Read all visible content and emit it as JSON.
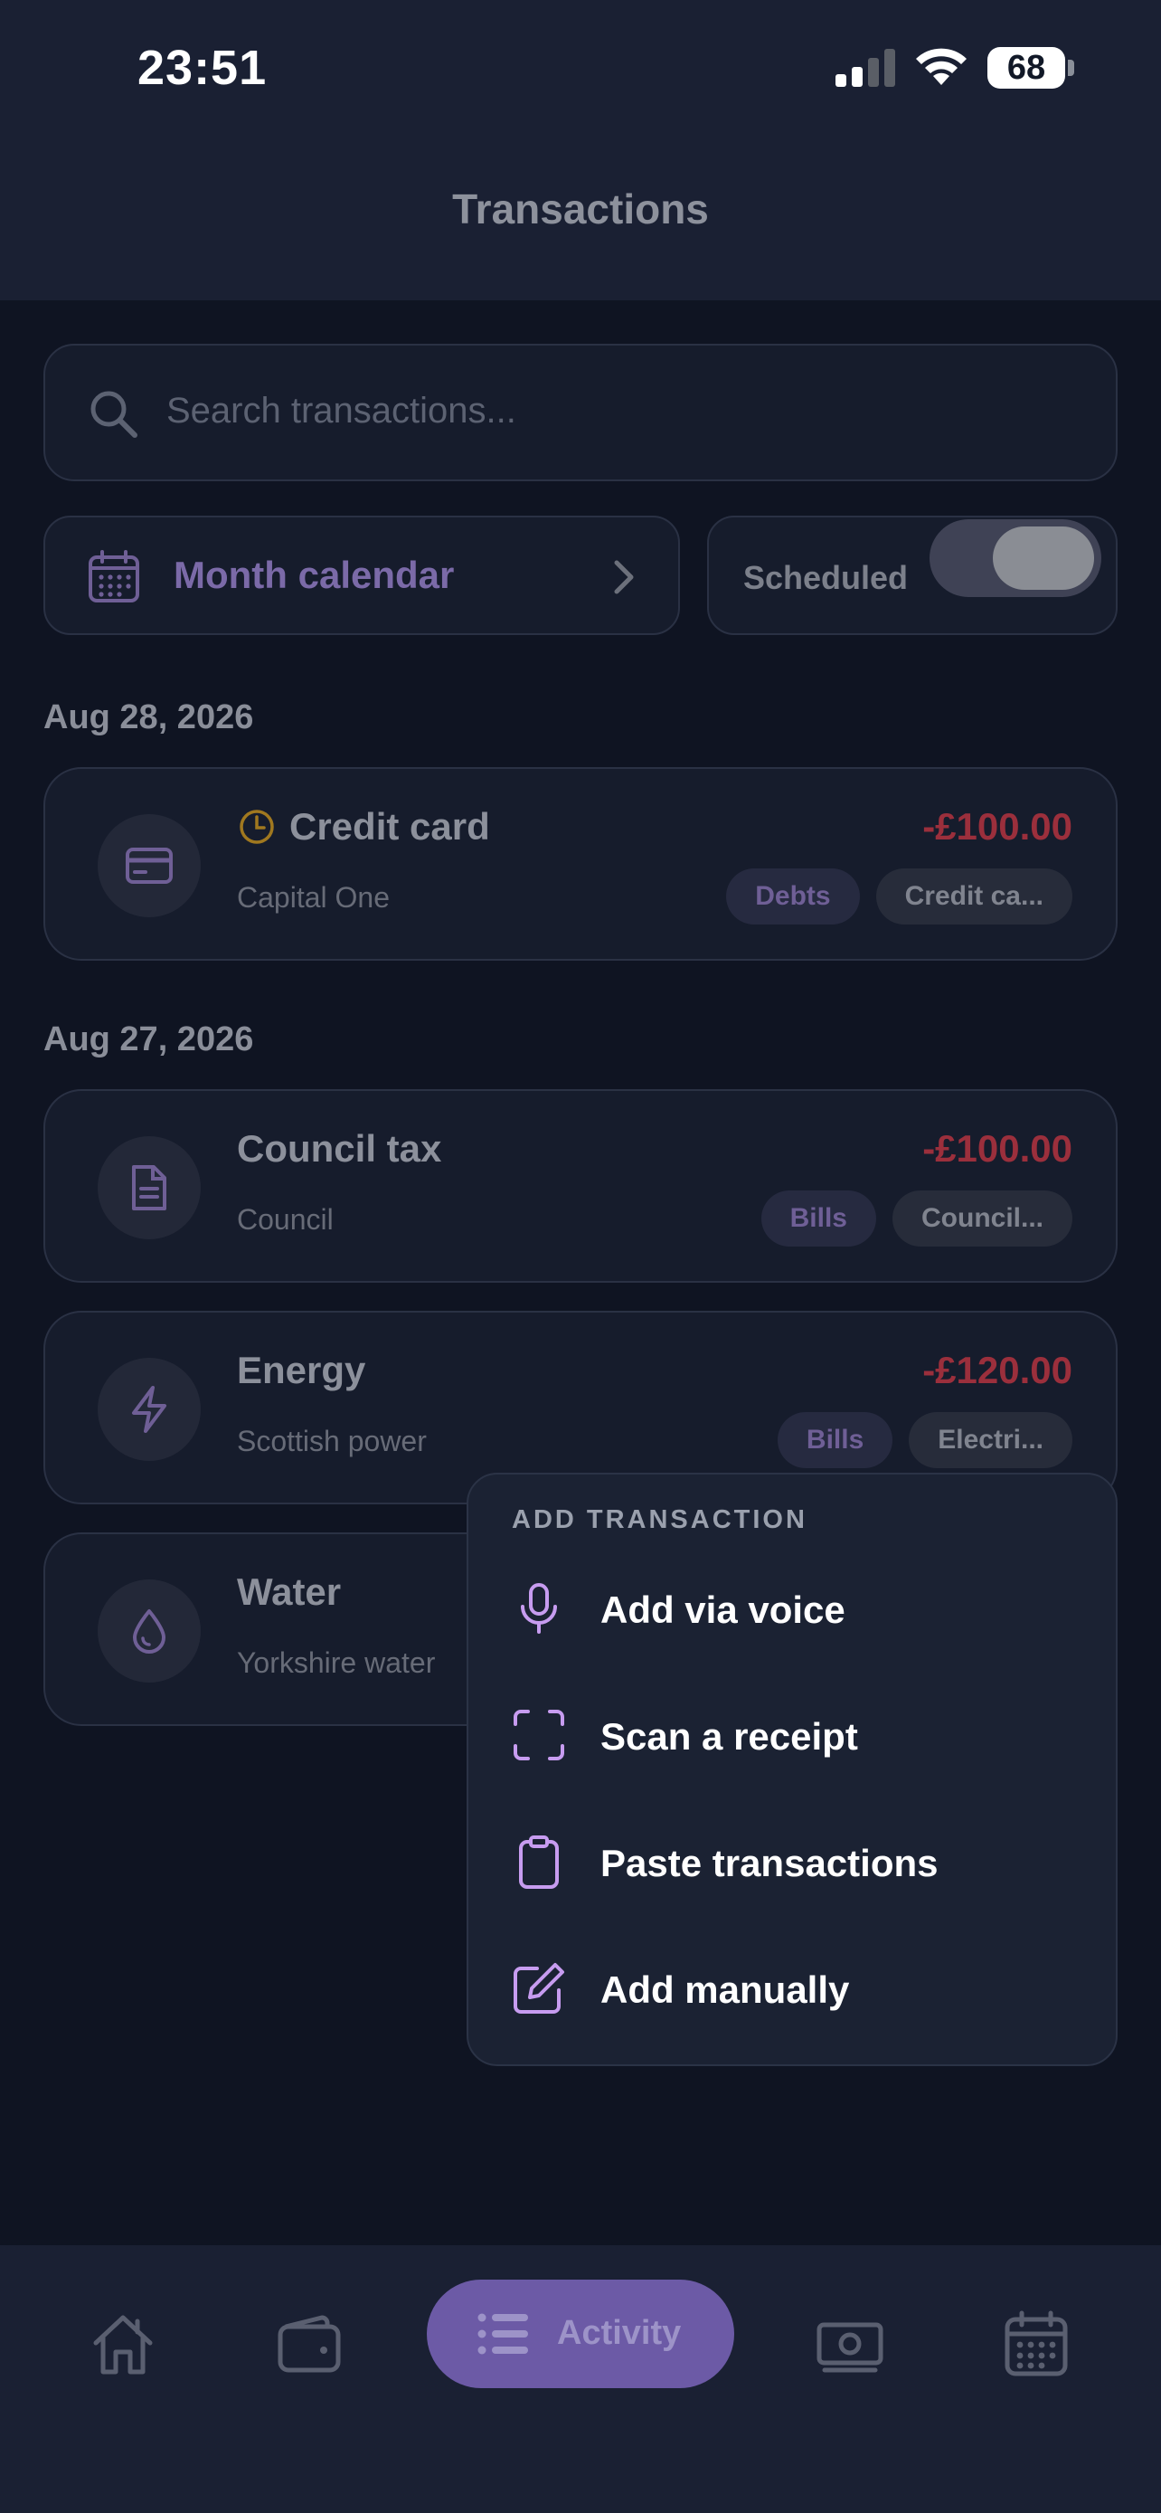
{
  "status_bar": {
    "time": "23:51",
    "battery": "68"
  },
  "header": {
    "title": "Transactions"
  },
  "search": {
    "placeholder": "Search transactions..."
  },
  "month_calendar": {
    "label": "Month calendar"
  },
  "scheduled": {
    "label": "Scheduled",
    "on": true
  },
  "groups": [
    {
      "date": "Aug 28, 2026",
      "transactions": [
        {
          "name": "Credit card",
          "merchant": "Capital One",
          "amount": "-£100.00",
          "category": "Debts",
          "subcategory": "Credit ca...",
          "icon": "credit-card-icon",
          "scheduled": true
        }
      ]
    },
    {
      "date": "Aug 27, 2026",
      "transactions": [
        {
          "name": "Council tax",
          "merchant": "Council",
          "amount": "-£100.00",
          "category": "Bills",
          "subcategory": "Council...",
          "icon": "document-icon"
        },
        {
          "name": "Energy",
          "merchant": "Scottish power",
          "amount": "-£120.00",
          "category": "Bills",
          "subcategory": "Electri...",
          "icon": "lightning-icon"
        },
        {
          "name": "Water",
          "merchant": "Yorkshire water",
          "icon": "water-drop-icon"
        }
      ]
    }
  ],
  "add_menu": {
    "title": "ADD TRANSACTION",
    "items": [
      {
        "label": "Add via voice",
        "icon": "microphone-icon"
      },
      {
        "label": "Scan a receipt",
        "icon": "scan-frame-icon"
      },
      {
        "label": "Paste transactions",
        "icon": "clipboard-icon"
      },
      {
        "label": "Add manually",
        "icon": "edit-icon"
      }
    ]
  },
  "nav": {
    "items": [
      "home-icon",
      "wallet-icon",
      "activity",
      "banknote-icon",
      "calendar-icon"
    ],
    "active_label": "Activity"
  },
  "colors": {
    "background": "#0f1422",
    "accent": "#6c5aa6",
    "negative_amount": "#9b2f3c",
    "menu_icon": "#c79cf0"
  }
}
